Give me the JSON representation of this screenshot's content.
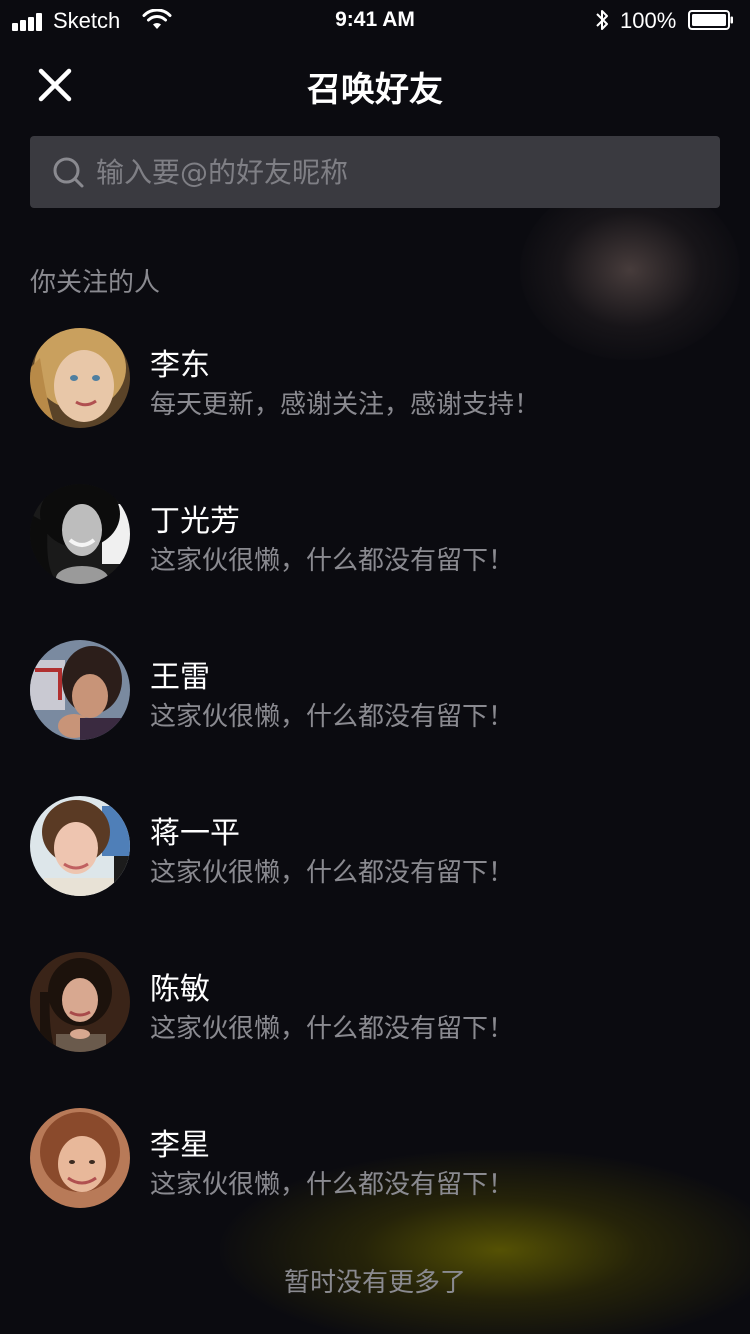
{
  "status_bar": {
    "carrier": "Sketch",
    "time": "9:41 AM",
    "battery": "100%"
  },
  "header": {
    "title": "召唤好友",
    "close_icon": "close-icon"
  },
  "search": {
    "placeholder": "输入要@的好友昵称",
    "value": "",
    "icon": "search-icon"
  },
  "section": {
    "title": "你关注的人"
  },
  "friends": [
    {
      "name": "李东",
      "bio": "每天更新，感谢关注，感谢支持！"
    },
    {
      "name": "丁光芳",
      "bio": "这家伙很懒，什么都没有留下！"
    },
    {
      "name": "王雷",
      "bio": "这家伙很懒，什么都没有留下！"
    },
    {
      "name": "蒋一平",
      "bio": "这家伙很懒，什么都没有留下！"
    },
    {
      "name": "陈敏",
      "bio": "这家伙很懒，什么都没有留下！"
    },
    {
      "name": "李星",
      "bio": "这家伙很懒，什么都没有留下！"
    }
  ],
  "footer": {
    "no_more": "暂时没有更多了"
  },
  "colors": {
    "background": "#0b0b10",
    "search_bg": "#3a3a40",
    "secondary_text": "#8a8a90",
    "accent_glow": "#6e6900"
  }
}
